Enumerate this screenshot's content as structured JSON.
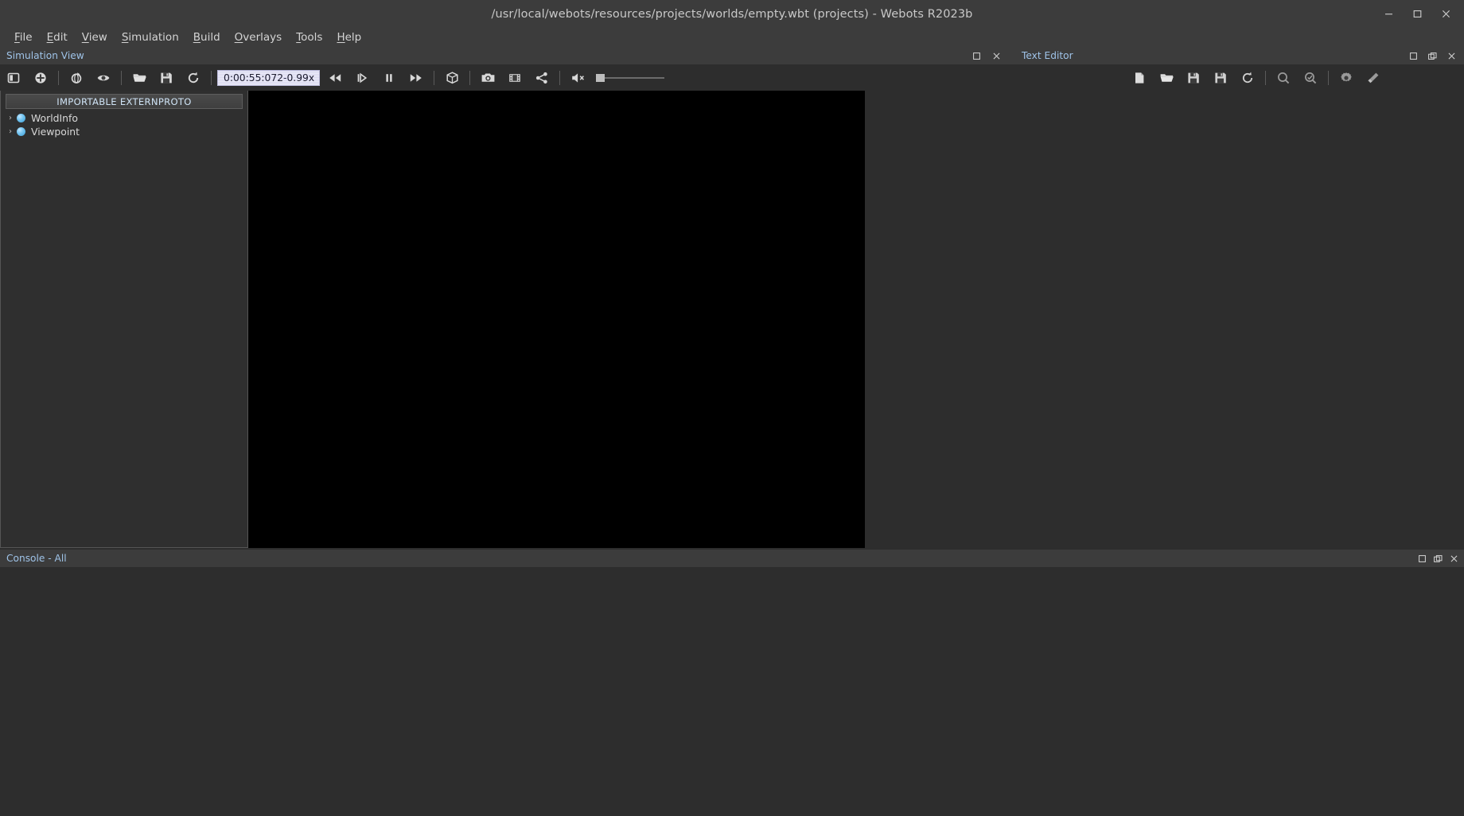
{
  "window": {
    "title": "/usr/local/webots/resources/projects/worlds/empty.wbt (projects) - Webots R2023b",
    "minimize_label": "minimize-icon",
    "maximize_label": "maximize-icon",
    "close_label": "close-icon"
  },
  "menubar": {
    "items": [
      {
        "label": "File",
        "mnemonic": "F"
      },
      {
        "label": "Edit",
        "mnemonic": "E"
      },
      {
        "label": "View",
        "mnemonic": "V"
      },
      {
        "label": "Simulation",
        "mnemonic": "S"
      },
      {
        "label": "Build",
        "mnemonic": "B"
      },
      {
        "label": "Overlays",
        "mnemonic": "O"
      },
      {
        "label": "Tools",
        "mnemonic": "T"
      },
      {
        "label": "Help",
        "mnemonic": "H"
      }
    ]
  },
  "panels": {
    "simulation_view": {
      "label": "Simulation View"
    },
    "text_editor": {
      "label": "Text Editor",
      "undock": "▫",
      "close": "✕"
    },
    "console": {
      "label": "Console - All"
    }
  },
  "simulation_toolbar": {
    "buttons": [
      {
        "name": "toggle-sidebar-icon",
        "tooltip": "Toggle sidebar"
      },
      {
        "name": "add-node-icon",
        "tooltip": "Add a node"
      },
      {
        "name": "orientation-icon",
        "tooltip": "Change viewpoint"
      },
      {
        "name": "view-icon",
        "tooltip": "View"
      },
      {
        "name": "open-world-icon",
        "tooltip": "Open world"
      },
      {
        "name": "save-world-icon",
        "tooltip": "Save world"
      },
      {
        "name": "reload-world-icon",
        "tooltip": "Reload world"
      },
      {
        "name": "rewind-icon",
        "tooltip": "Reset simulation"
      },
      {
        "name": "step-icon",
        "tooltip": "Step"
      },
      {
        "name": "pause-icon",
        "tooltip": "Pause"
      },
      {
        "name": "fast-forward-icon",
        "tooltip": "Fast mode"
      },
      {
        "name": "render-3d-icon",
        "tooltip": "Rendering"
      },
      {
        "name": "camera-icon",
        "tooltip": "Take screenshot"
      },
      {
        "name": "movie-icon",
        "tooltip": "Make movie"
      },
      {
        "name": "share-icon",
        "tooltip": "Share"
      },
      {
        "name": "sound-muted-icon",
        "tooltip": "Sound volume"
      }
    ],
    "time": "0:00:55:072",
    "separator": "-",
    "speed": "0.99x",
    "volume_value": 0
  },
  "editor_toolbar": {
    "buttons": [
      {
        "name": "new-file-icon",
        "tooltip": "New text file"
      },
      {
        "name": "open-file-icon",
        "tooltip": "Open text file"
      },
      {
        "name": "save-file-icon",
        "tooltip": "Save file"
      },
      {
        "name": "save-as-file-icon",
        "tooltip": "Save file as"
      },
      {
        "name": "revert-file-icon",
        "tooltip": "Revert file"
      },
      {
        "name": "find-icon",
        "tooltip": "Find"
      },
      {
        "name": "find-replace-icon",
        "tooltip": "Find and replace"
      },
      {
        "name": "gear-icon",
        "tooltip": "Settings"
      },
      {
        "name": "clean-icon",
        "tooltip": "Clean"
      }
    ]
  },
  "scene_tree": {
    "externproto_button": "IMPORTABLE EXTERNPROTO",
    "nodes": [
      {
        "label": "WorldInfo",
        "expander": "›",
        "icon": "node-sphere-icon"
      },
      {
        "label": "Viewpoint",
        "expander": "›",
        "icon": "node-sphere-icon"
      }
    ]
  },
  "colors": {
    "titlebar": "#3c3c3c",
    "background": "#2d2d2d",
    "panel_label": "#9fc3e8",
    "viewport": "#000000",
    "time_field": "#d8d7f0",
    "node_icon": "#74c4f0"
  }
}
